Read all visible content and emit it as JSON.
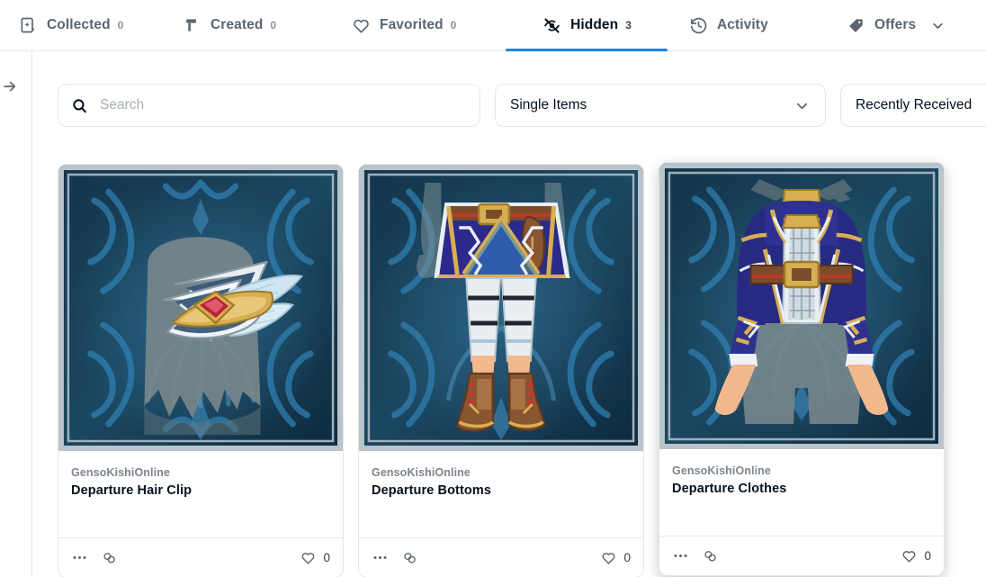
{
  "tabs": [
    {
      "id": "collected",
      "icon": "collected-icon",
      "label": "Collected",
      "count": "0",
      "active": false,
      "has_chevron": false
    },
    {
      "id": "created",
      "icon": "created-icon",
      "label": "Created",
      "count": "0",
      "active": false,
      "has_chevron": false
    },
    {
      "id": "favorited",
      "icon": "heart-icon",
      "label": "Favorited",
      "count": "0",
      "active": false,
      "has_chevron": false
    },
    {
      "id": "hidden",
      "icon": "eye-slash-icon",
      "label": "Hidden",
      "count": "3",
      "active": true,
      "has_chevron": false
    },
    {
      "id": "activity",
      "icon": "clock-rewind-icon",
      "label": "Activity",
      "count": "",
      "active": false,
      "has_chevron": false
    },
    {
      "id": "offers",
      "icon": "tag-icon",
      "label": "Offers",
      "count": "",
      "active": false,
      "has_chevron": true
    }
  ],
  "sidebar": {
    "expand_icon": "arrow-right-icon"
  },
  "filters": {
    "search": {
      "icon": "search-icon",
      "value": "",
      "placeholder": "Search"
    },
    "grouping": {
      "label": "Single Items",
      "chevron": "chevron-down-icon"
    },
    "sort": {
      "label": "Recently Received"
    }
  },
  "cards": [
    {
      "collection": "GensoKishiOnline",
      "name": "Departure Hair Clip",
      "favorites": "0",
      "more_icon": "more-options-icon",
      "link_icon": "chain-link-icon",
      "favorite_icon": "heart-icon",
      "art": "hair-clip",
      "hovered": false
    },
    {
      "collection": "GensoKishiOnline",
      "name": "Departure Bottoms",
      "favorites": "0",
      "more_icon": "more-options-icon",
      "link_icon": "chain-link-icon",
      "favorite_icon": "heart-icon",
      "art": "bottoms",
      "hovered": false
    },
    {
      "collection": "GensoKishiOnline",
      "name": "Departure Clothes",
      "favorites": "0",
      "more_icon": "more-options-icon",
      "link_icon": "chain-link-icon",
      "favorite_icon": "heart-icon",
      "art": "clothes",
      "hovered": true
    }
  ],
  "colors": {
    "accent": "#2081e2",
    "text_primary": "#04111d",
    "text_muted": "#5b6671",
    "border": "#e5e8eb",
    "art_bg_dark": "#15394f",
    "art_bg_mid": "#1d4f6d",
    "art_swirl": "#2e7aa8",
    "art_frame": "#b9c4cb"
  }
}
